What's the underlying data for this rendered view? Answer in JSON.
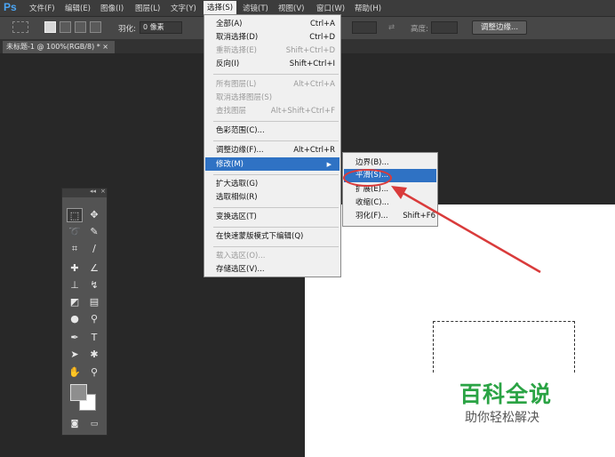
{
  "app": {
    "logo": "Ps"
  },
  "menubar": {
    "items": [
      "文件(F)",
      "编辑(E)",
      "图像(I)",
      "图层(L)",
      "文字(Y)",
      "选择(S)",
      "滤镜(T)",
      "视图(V)",
      "窗口(W)",
      "帮助(H)"
    ]
  },
  "options": {
    "feather_label": "羽化:",
    "feather_value": "0 像素",
    "height_label": "高度:",
    "refine_button": "调整边缘..."
  },
  "tabs": {
    "document": "未标题-1 @ 100%(RGB/8) *  ×"
  },
  "select_menu": {
    "items": [
      {
        "label": "全部(A)",
        "shortcut": "Ctrl+A",
        "disabled": false
      },
      {
        "label": "取消选择(D)",
        "shortcut": "Ctrl+D",
        "disabled": false
      },
      {
        "label": "重新选择(E)",
        "shortcut": "Shift+Ctrl+D",
        "disabled": true
      },
      {
        "label": "反向(I)",
        "shortcut": "Shift+Ctrl+I",
        "disabled": false
      },
      {
        "label": "所有图层(L)",
        "shortcut": "Alt+Ctrl+A",
        "disabled": true
      },
      {
        "label": "取消选择图层(S)",
        "shortcut": "",
        "disabled": true
      },
      {
        "label": "查找图层",
        "shortcut": "Alt+Shift+Ctrl+F",
        "disabled": true
      },
      {
        "label": "色彩范围(C)...",
        "shortcut": "",
        "disabled": false
      },
      {
        "label": "调整边缘(F)...",
        "shortcut": "Alt+Ctrl+R",
        "disabled": false
      },
      {
        "label": "修改(M)",
        "shortcut": "",
        "disabled": false
      },
      {
        "label": "扩大选取(G)",
        "shortcut": "",
        "disabled": false
      },
      {
        "label": "选取相似(R)",
        "shortcut": "",
        "disabled": false
      },
      {
        "label": "变换选区(T)",
        "shortcut": "",
        "disabled": false
      },
      {
        "label": "在快速蒙版模式下编辑(Q)",
        "shortcut": "",
        "disabled": false
      },
      {
        "label": "载入选区(O)...",
        "shortcut": "",
        "disabled": true
      },
      {
        "label": "存储选区(V)...",
        "shortcut": "",
        "disabled": false
      }
    ]
  },
  "modify_submenu": {
    "items": [
      {
        "label": "边界(B)...",
        "shortcut": ""
      },
      {
        "label": "平滑(S)...",
        "shortcut": ""
      },
      {
        "label": "扩展(E)...",
        "shortcut": ""
      },
      {
        "label": "收缩(C)...",
        "shortcut": ""
      },
      {
        "label": "羽化(F)...",
        "shortcut": "Shift+F6"
      }
    ]
  },
  "watermark": {
    "title": "百科全说",
    "subtitle": "助你轻松解决"
  },
  "colors": {
    "highlight": "#2f72c4",
    "annotation": "#d93b3b",
    "brand_green": "#2aa344"
  }
}
